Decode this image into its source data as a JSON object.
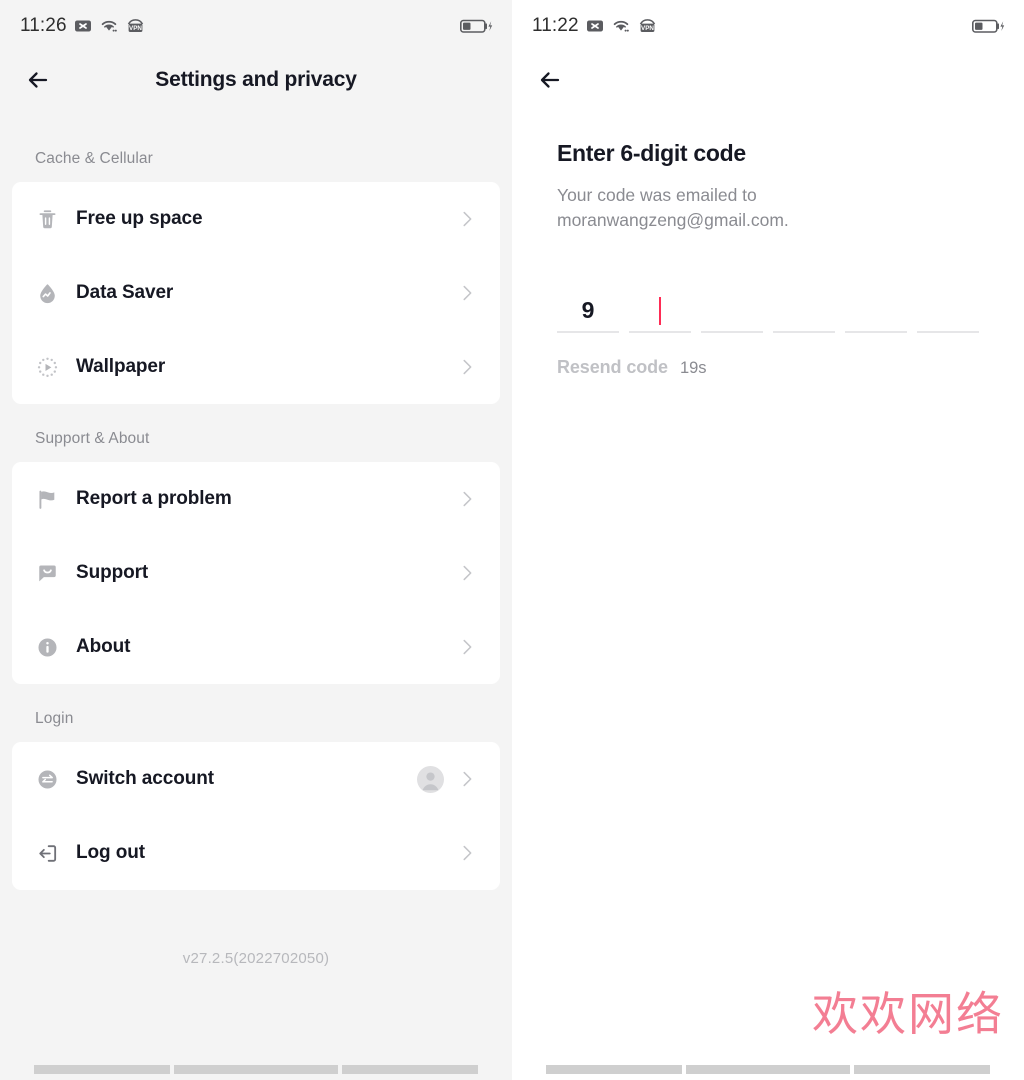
{
  "left_screen": {
    "status_bar": {
      "time": "11:26",
      "icons": [
        "mute-x-icon",
        "wifi-icon",
        "vpn-icon"
      ],
      "battery": "battery-charging-icon"
    },
    "header": {
      "back": "back-arrow-icon",
      "title": "Settings and privacy"
    },
    "groups": [
      {
        "title": "Cache & Cellular",
        "items": [
          {
            "label": "Free up space",
            "icon": "trash-icon"
          },
          {
            "label": "Data Saver",
            "icon": "data-saver-droplet-icon"
          },
          {
            "label": "Wallpaper",
            "icon": "wallpaper-play-icon"
          }
        ]
      },
      {
        "title": "Support & About",
        "items": [
          {
            "label": "Report a problem",
            "icon": "flag-icon"
          },
          {
            "label": "Support",
            "icon": "chat-bubble-icon"
          },
          {
            "label": "About",
            "icon": "info-circle-icon"
          }
        ]
      },
      {
        "title": "Login",
        "items": [
          {
            "label": "Switch account",
            "icon": "switch-arrows-icon",
            "avatar": "user-avatar"
          },
          {
            "label": "Log out",
            "icon": "logout-icon"
          }
        ]
      }
    ],
    "version": "v27.2.5(2022702050)"
  },
  "right_screen": {
    "status_bar": {
      "time": "11:22",
      "icons": [
        "mute-x-icon",
        "wifi-icon",
        "vpn-icon"
      ],
      "battery": "battery-charging-icon"
    },
    "header": {
      "back": "back-arrow-icon"
    },
    "title": "Enter 6-digit code",
    "subtitle": "Your code was emailed to moranwangzeng@gmail.com.",
    "code_slots": [
      "9",
      "",
      "",
      "",
      "",
      ""
    ],
    "active_slot_index": 1,
    "resend_label": "Resend code",
    "timer": "19s",
    "watermark": "欢欢网络"
  },
  "colors": {
    "background": "#f4f4f4",
    "card": "#ffffff",
    "text_primary": "#161823",
    "text_secondary": "#8a8b91",
    "accent_red": "#fe2c55",
    "watermark": "#f3748a"
  }
}
